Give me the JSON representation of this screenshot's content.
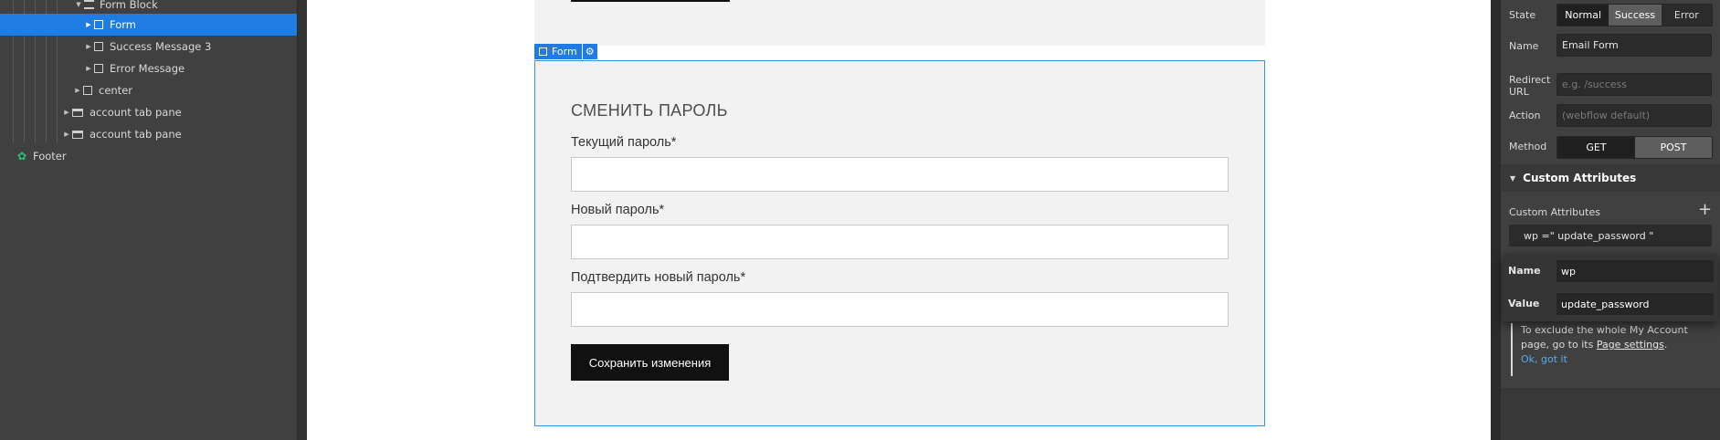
{
  "navigator": {
    "items": [
      {
        "label": "Form Block",
        "kind": "form-block"
      },
      {
        "label": "Form",
        "kind": "box",
        "selected": true
      },
      {
        "label": "Success Message 3",
        "kind": "box"
      },
      {
        "label": "Error Message",
        "kind": "box"
      },
      {
        "label": "center",
        "kind": "box"
      },
      {
        "label": "account tab pane",
        "kind": "pane"
      },
      {
        "label": "account tab pane",
        "kind": "pane"
      },
      {
        "label": "Footer",
        "kind": "symbol"
      }
    ]
  },
  "canvas": {
    "form_tag": {
      "label": "Form"
    },
    "form": {
      "heading": "СМЕНИТЬ ПАРОЛЬ",
      "fields": [
        {
          "label": "Текущий пароль*",
          "value": ""
        },
        {
          "label": "Новый пароль*",
          "value": ""
        },
        {
          "label": "Подтвердить новый пароль*",
          "value": ""
        }
      ],
      "submit_label": "Сохранить изменения"
    }
  },
  "settings": {
    "state": {
      "label": "State",
      "options": [
        "Normal",
        "Success",
        "Error"
      ],
      "selected": "Normal"
    },
    "name": {
      "label": "Name",
      "value": "Email Form"
    },
    "redirect": {
      "label_line1": "Redirect",
      "label_line2": "URL",
      "placeholder": "e.g. /success"
    },
    "action": {
      "label": "Action",
      "placeholder": "(webflow default)"
    },
    "method": {
      "label": "Method",
      "options": [
        "GET",
        "POST"
      ],
      "selected": "POST"
    },
    "custom_attributes": {
      "section_title": "Custom Attributes",
      "list_title": "Custom Attributes",
      "chip": "wp =\" update_password \"",
      "editor": {
        "name_label": "Name",
        "name_value": "wp",
        "value_label": "Value",
        "value_value": "update_password"
      }
    },
    "note": {
      "text_1": "To exclude the whole My Account",
      "text_2": "page, go to its ",
      "link": "Page settings",
      "text_3": ".",
      "ok": "Ok, got it"
    }
  },
  "colors": {
    "accent": "#1e7ce3",
    "panel_bg": "#404040",
    "canvas_block": "#f2f2f2",
    "button_dark": "#111111"
  }
}
